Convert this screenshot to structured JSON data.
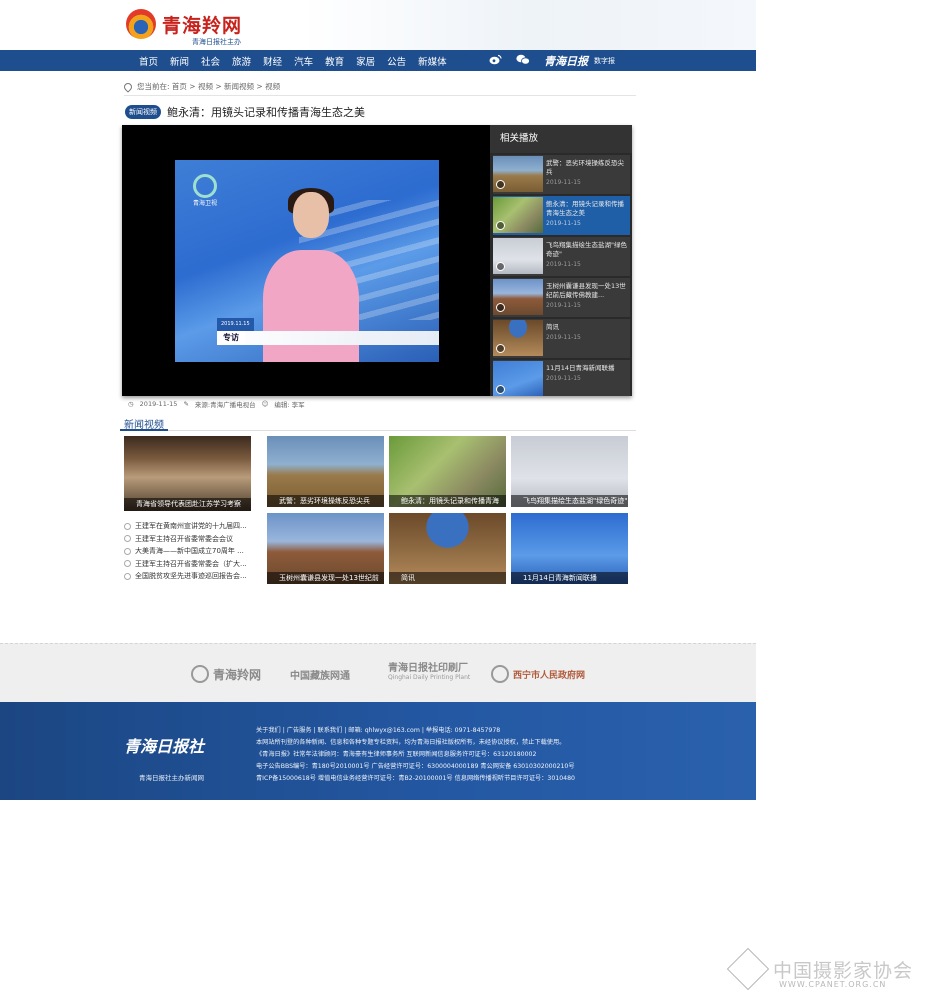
{
  "header": {
    "logo_text": "青海羚网",
    "logo_sub": "青海日报社主办"
  },
  "nav": {
    "items": [
      "首页",
      "新闻",
      "社会",
      "旅游",
      "财经",
      "汽车",
      "教育",
      "家居",
      "公告",
      "新媒体"
    ],
    "brand": "青海日报",
    "digital": "数字报",
    "icons": [
      "weibo-icon",
      "wechat-icon"
    ]
  },
  "breadcrumb": "您当前在: 首页 > 视频 > 新闻视频 > 视频",
  "article": {
    "badge": "新闻视频",
    "title": "鲍永清：用镜头记录和传播青海生态之美"
  },
  "player": {
    "channel_name": "青海卫视",
    "lower_tag": "2019.11.15",
    "lower_label": "专访"
  },
  "related": {
    "title": "相关播放",
    "items": [
      {
        "name": "武警：恶劣环境操练反恐尖兵",
        "date": "2019-11-15",
        "thumb": "th-army"
      },
      {
        "name": "鲍永清：用镜头记录和传播青海生态之美",
        "date": "2019-11-15",
        "thumb": "th-bird"
      },
      {
        "name": "飞鸟翔集描绘生态盐湖\"绿色奇迹\"",
        "date": "2019-11-15",
        "thumb": "th-sky"
      },
      {
        "name": "玉树州囊谦县发现一处13世纪前后藏传佛教建...",
        "date": "2019-11-15",
        "thumb": "th-mountain"
      },
      {
        "name": "简讯",
        "date": "2019-11-15",
        "thumb": "th-meeting"
      },
      {
        "name": "11月14日青海新闻联播",
        "date": "2019-11-15",
        "thumb": "th-news-small"
      }
    ]
  },
  "meta": {
    "date": "2019-11-15",
    "source": "来源:青海广播电视台",
    "editor": "编辑: 李军"
  },
  "section": {
    "title": "新闻视频",
    "feature_caption": "青海省领导代表团赴江苏学习考察",
    "list": [
      "王建军在黄南州宣讲党的十九届四...",
      "王建军主持召开省委常委会会议",
      "大美青海——新中国成立70周年 ...",
      "王建军主持召开省委常委会（扩大...",
      "全国脱贫攻坚先进事迹巡回报告会..."
    ],
    "tiles": [
      {
        "caption": "武警：恶劣环境操练反恐尖兵",
        "thumb": "th-army"
      },
      {
        "caption": "鲍永清：用镜头记录和传播青海",
        "thumb": "th-bird"
      },
      {
        "caption": "飞鸟翔集描绘生态盐湖\"绿色奇迹\"",
        "thumb": "th-sky"
      },
      {
        "caption": "玉树州囊谦县发现一处13世纪前",
        "thumb": "th-mountain"
      },
      {
        "caption": "简讯",
        "thumb": "th-meeting"
      },
      {
        "caption": "11月14日青海新闻联播",
        "thumb": "th-news"
      }
    ]
  },
  "partners": {
    "p1": "青海羚网",
    "p2": "中国藏族网通",
    "p3_name": "青海日报社印刷厂",
    "p3_sub": "Qinghai Daily Printing Plant",
    "p4_name": "西宁市人民政府网"
  },
  "footer": {
    "brand": "青海日报社",
    "brand_sub": "青海日报社主办新闻网",
    "lines": [
      "关于我们 | 广告服务 | 联系我们 | 邮箱: qhlwyx@163.com | 举报电话: 0971-8457978",
      "本网站所刊登的各种新闻、信息和各种专题专栏资料，均为青海日报社版权所有，未经协议授权，禁止下载使用。",
      "《青海日报》社常年法律顾问：青海豪有生律师事务所  互联网新闻信息服务许可证号：63120180002",
      "电子公告BBS编号：青180号2010001号 广告经营许可证号：6300004000189 青公网安备 63010302000210号",
      "青ICP备15000618号 增值电信业务经营许可证号：青B2-20100001号 信息网络传播视听节目许可证号：3010480"
    ]
  },
  "watermark": {
    "text": "中国摄影家协会",
    "url": "WWW.CPANET.ORG.CN"
  }
}
